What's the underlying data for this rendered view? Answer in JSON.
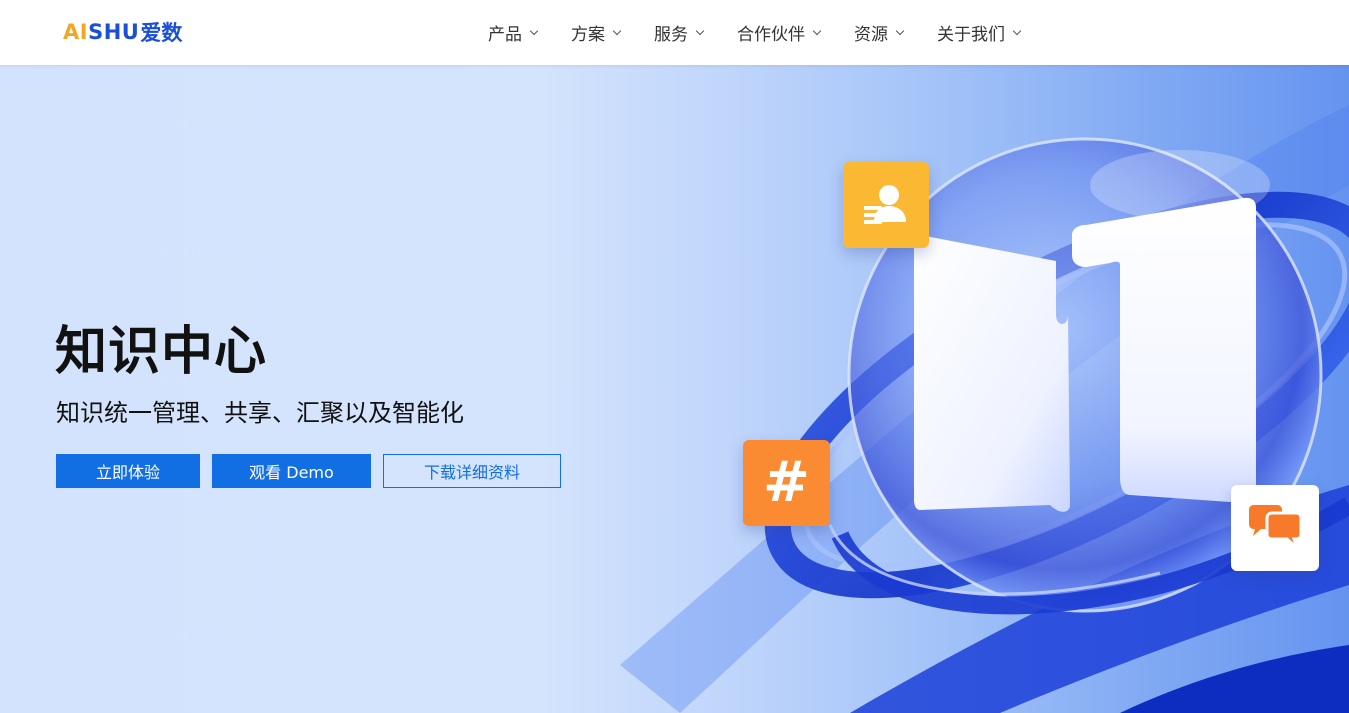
{
  "header": {
    "logo": {
      "part1": "AI",
      "part2": "SHU",
      "part3": "爱数"
    },
    "nav": [
      {
        "label": "产品"
      },
      {
        "label": "方案"
      },
      {
        "label": "服务"
      },
      {
        "label": "合作伙伴"
      },
      {
        "label": "资源"
      },
      {
        "label": "关于我们"
      }
    ]
  },
  "hero": {
    "title": "知识中心",
    "subtitle": "知识统一管理、共享、汇聚以及智能化",
    "buttons": {
      "try": "立即体验",
      "demo": "观看 Demo",
      "download": "下载详细资料"
    },
    "icons": {
      "user_card": "user-card-icon",
      "hashtag": "#",
      "chat": "chat-bubbles-icon"
    }
  },
  "colors": {
    "brand_blue": "#126ee3",
    "logo_orange": "#f5a623",
    "logo_blue": "#1a4fd6",
    "tile_yellow": "#fbb832",
    "tile_orange": "#fa8b32",
    "chat_orange": "#f7792a"
  }
}
